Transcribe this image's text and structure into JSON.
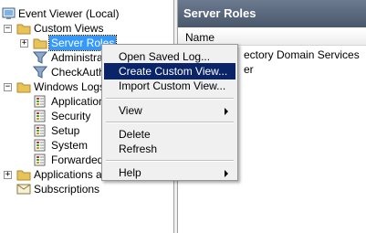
{
  "tree": {
    "root": {
      "label": "Event Viewer (Local)",
      "icon": "event-viewer-icon"
    },
    "custom_views": {
      "label": "Custom Views",
      "icon": "folder-icon"
    },
    "server_roles": {
      "label": "Server Roles",
      "icon": "folder-icon"
    },
    "administrative": {
      "label": "Administrati",
      "icon": "filter-funnel-icon"
    },
    "check_authentication": {
      "label": "CheckAuthe",
      "icon": "filter-funnel-icon"
    },
    "windows_logs": {
      "label": "Windows Logs",
      "icon": "folder-icon"
    },
    "application": {
      "label": "Application",
      "icon": "log-icon"
    },
    "security": {
      "label": "Security",
      "icon": "log-icon"
    },
    "setup": {
      "label": "Setup",
      "icon": "log-icon"
    },
    "system": {
      "label": "System",
      "icon": "log-icon"
    },
    "forwarded": {
      "label": "Forwarded",
      "icon": "log-icon"
    },
    "apps_services": {
      "label": "Applications and",
      "icon": "folder-icon"
    },
    "subscriptions": {
      "label": "Subscriptions",
      "icon": "subscriptions-icon"
    },
    "expand_glyph": "+",
    "collapse_glyph": "−"
  },
  "right_pane": {
    "title": "Server Roles",
    "column_name": "Name",
    "rows": [
      "Active Directory Domain Services",
      "DNS Server"
    ],
    "visible_rows": [
      "ectory Domain Services",
      "er"
    ]
  },
  "context_menu": {
    "items": [
      {
        "label": "Open Saved Log..."
      },
      {
        "label": "Create Custom View...",
        "highlighted": true
      },
      {
        "label": "Import Custom View..."
      },
      {
        "label": "View",
        "submenu": true
      },
      {
        "label": "Delete"
      },
      {
        "label": "Refresh"
      },
      {
        "label": "Help",
        "submenu": true
      }
    ]
  },
  "colors": {
    "selection": "#3399ff",
    "menu_highlight": "#0a246a",
    "header_bg": "#5a687c",
    "folder": "#e8c35a"
  }
}
